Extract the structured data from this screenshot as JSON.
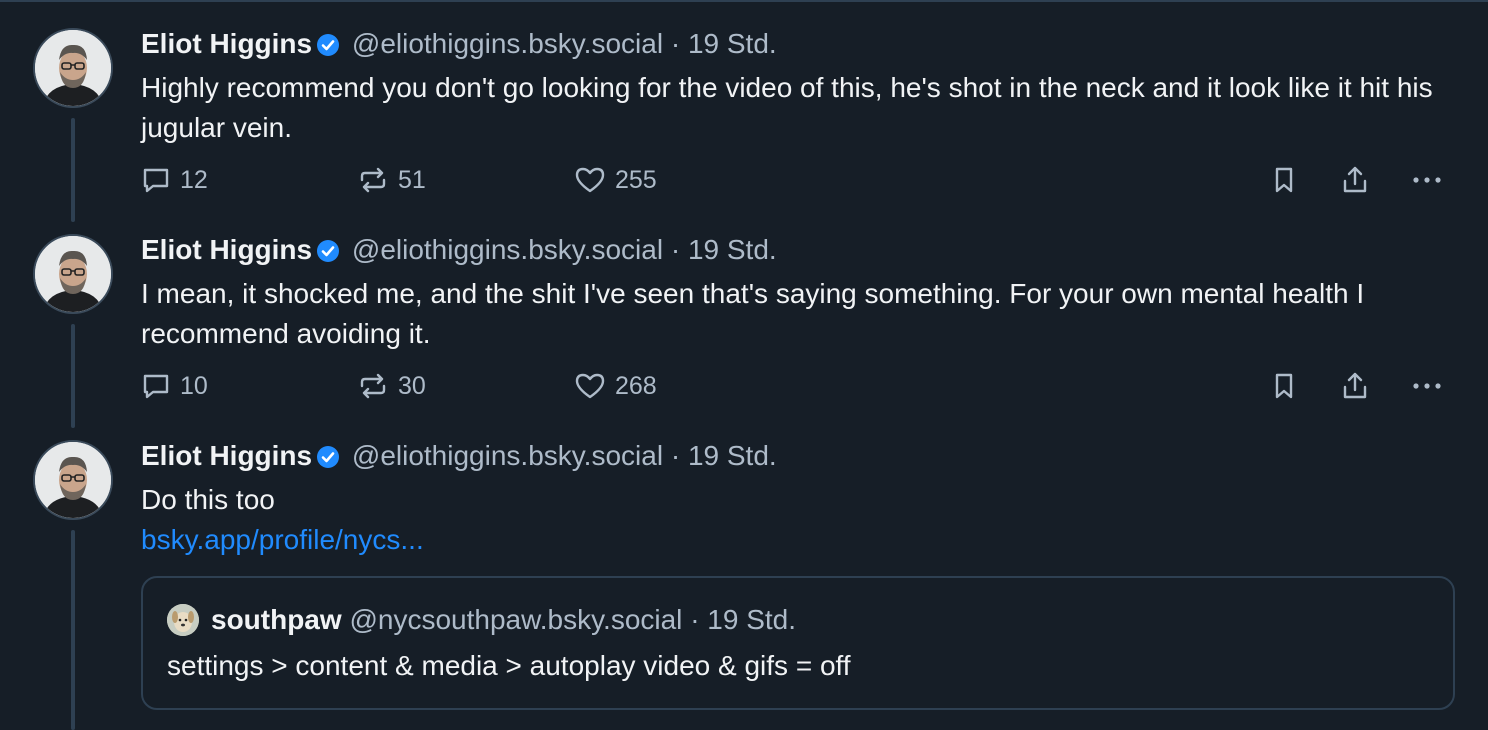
{
  "posts": [
    {
      "author": "Eliot Higgins",
      "handle": "@eliothiggins.bsky.social",
      "separator": "·",
      "time": "19 Std.",
      "text": "Highly recommend you don't go looking for the video of this, he's shot in the neck and it look like it hit his jugular vein.",
      "replies": "12",
      "reposts": "51",
      "likes": "255"
    },
    {
      "author": "Eliot Higgins",
      "handle": "@eliothiggins.bsky.social",
      "separator": "·",
      "time": "19 Std.",
      "text": "I mean, it shocked me, and the shit I've seen that's saying something. For your own mental health I recommend avoiding it.",
      "replies": "10",
      "reposts": "30",
      "likes": "268"
    },
    {
      "author": "Eliot Higgins",
      "handle": "@eliothiggins.bsky.social",
      "separator": "·",
      "time": "19 Std.",
      "text": "Do this too",
      "link": "bsky.app/profile/nycs...",
      "quote": {
        "author": "southpaw",
        "handle": "@nycsouthpaw.bsky.social",
        "separator": "·",
        "time": "19 Std.",
        "text": "settings > content & media > autoplay video & gifs = off"
      }
    }
  ],
  "icons": {
    "verified": "verified-badge-icon",
    "reply": "reply-bubble-icon",
    "repost": "repost-arrows-icon",
    "like": "heart-icon",
    "bookmark": "bookmark-icon",
    "share": "share-icon",
    "more": "more-options-icon"
  },
  "colors": {
    "background": "#161e27",
    "text": "#f1f3f5",
    "muted": "#aebbc9",
    "link": "#208bfe",
    "verified": "#208bfe",
    "border": "#2e4052"
  }
}
